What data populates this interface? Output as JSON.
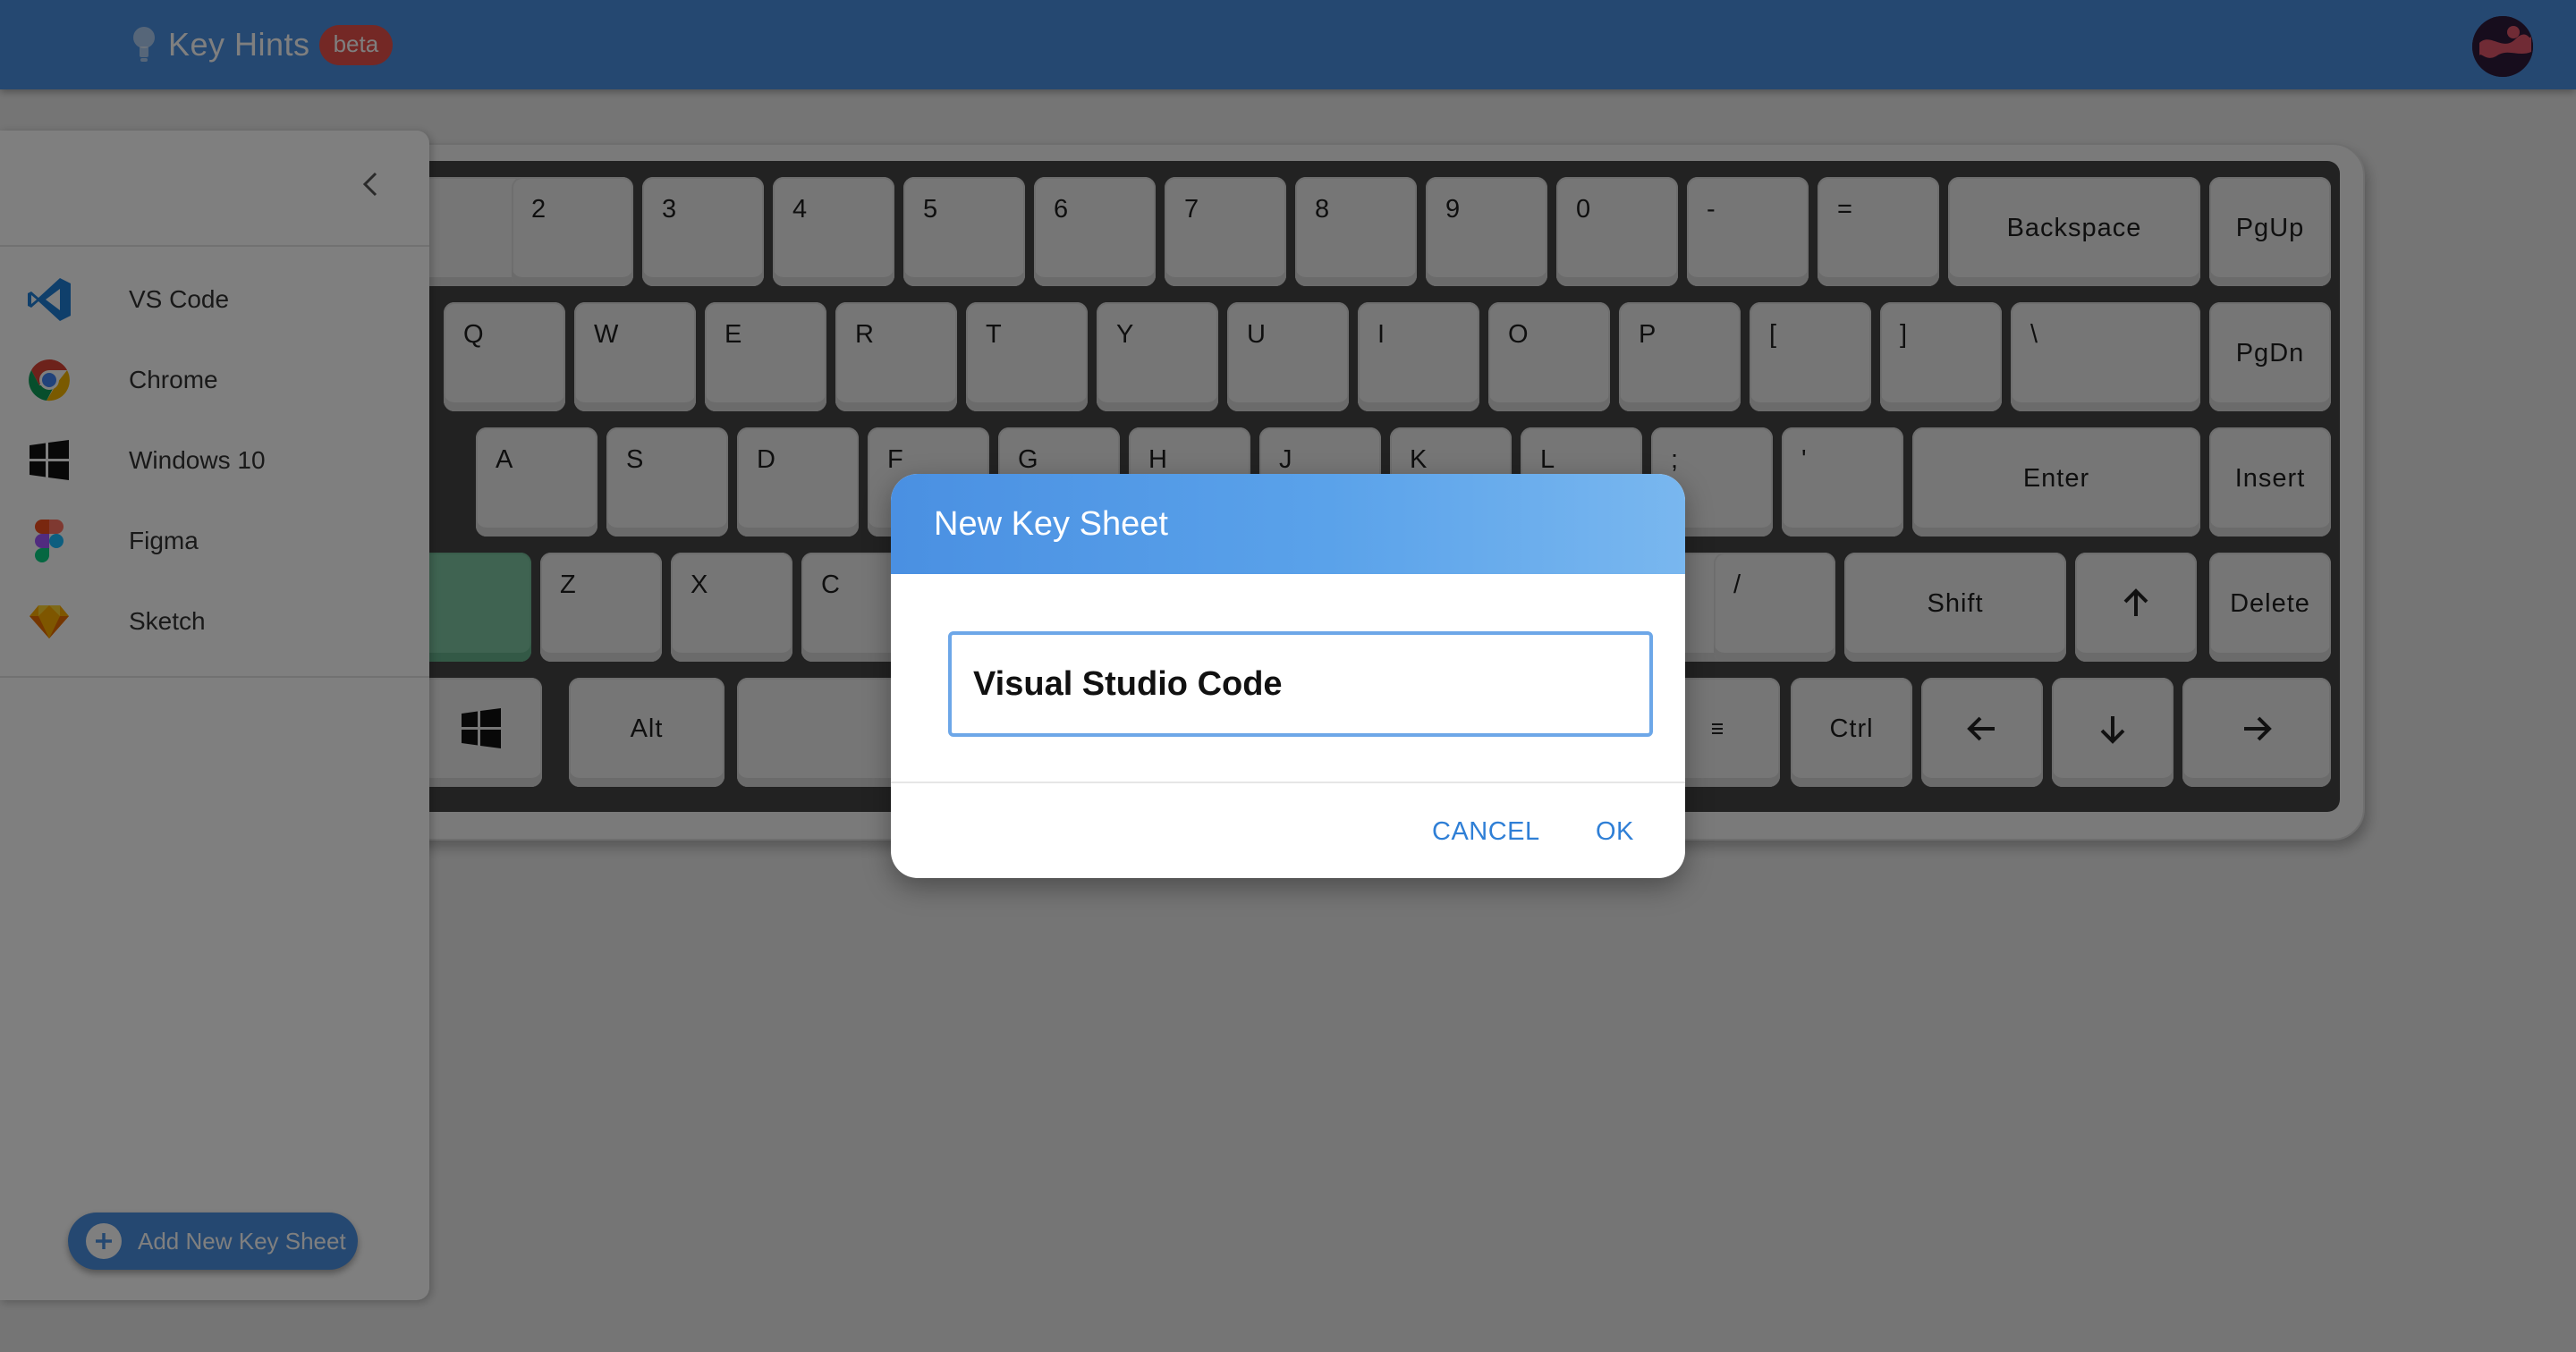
{
  "app": {
    "title": "Key Hints",
    "badge": "beta"
  },
  "keyboard": {
    "row1": [
      "2",
      "3",
      "4",
      "5",
      "6",
      "7",
      "8",
      "9",
      "0",
      "-",
      "=",
      "Backspace",
      "PgUp"
    ],
    "row2": [
      "Q",
      "W",
      "E",
      "R",
      "T",
      "Y",
      "U",
      "I",
      "O",
      "P",
      "[",
      "]",
      "\\",
      "PgDn"
    ],
    "row3": [
      "A",
      "S",
      "D",
      "F",
      "G",
      "H",
      "J",
      "K",
      "L",
      ";",
      "'",
      "Enter",
      "Insert"
    ],
    "row4": [
      "Z",
      "X",
      "C",
      "/",
      "Shift",
      "Delete"
    ],
    "row5": [
      "Alt",
      "Ctrl"
    ],
    "highlight_color": "#7ec7a3"
  },
  "sidebar": {
    "items": [
      {
        "label": "VS Code",
        "icon": "vscode-icon"
      },
      {
        "label": "Chrome",
        "icon": "chrome-icon"
      },
      {
        "label": "Windows 10",
        "icon": "windows-icon"
      },
      {
        "label": "Figma",
        "icon": "figma-icon"
      },
      {
        "label": "Sketch",
        "icon": "sketch-icon"
      }
    ],
    "add_button": "Add New Key Sheet"
  },
  "dialog": {
    "title": "New Key Sheet",
    "input_value": "Visual Studio Code",
    "cancel_label": "CANCEL",
    "ok_label": "OK"
  },
  "colors": {
    "primary": "#4a90e2",
    "badge": "#e8514a",
    "accent_text": "#2f7fd6"
  }
}
